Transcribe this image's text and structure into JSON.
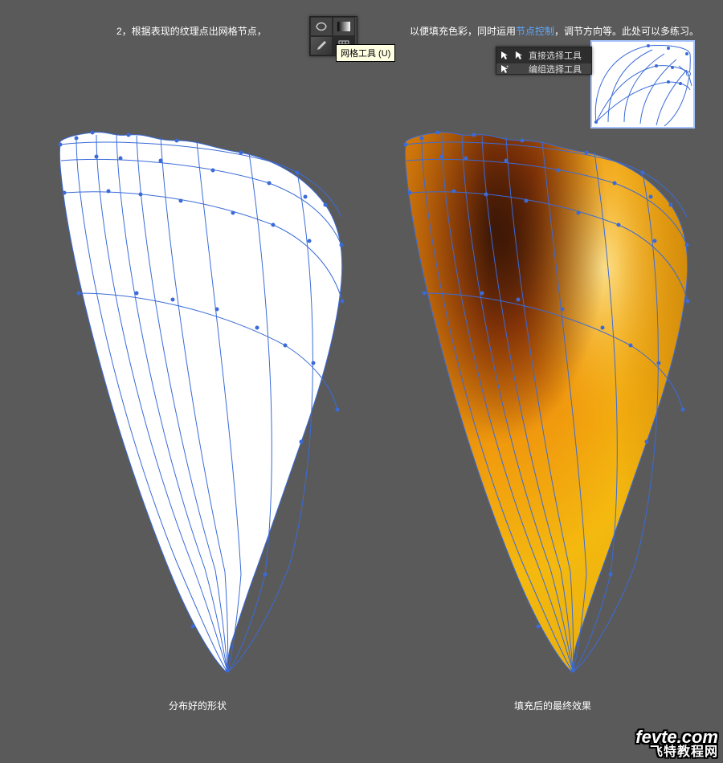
{
  "step_number": "2，",
  "instruction_left": "根据表现的纹理点出网格节点，",
  "instruction_right_a": "以便填充色彩，同时运用",
  "instruction_right_link": "节点控制",
  "instruction_right_b": "，调节方向等。此处可以多练习。",
  "mesh_tooltip": "网格工具 (U)",
  "flyout_row1": "直接选择工具",
  "flyout_row2": "编组选择工具",
  "caption_left": "分布好的形状",
  "caption_right": "填充后的最终效果",
  "watermark_top": "fevte.com",
  "watermark_bottom": "飞特教程网",
  "tool_panel_name": "mesh-tool-panel",
  "flyout_panel_name": "selection-flyout",
  "petal_left_alt": "Petal wireframe with mesh",
  "petal_right_alt": "Petal colored with mesh",
  "colors": {
    "mesh_line": "#3a6bd8",
    "petal_white": "#ffffff",
    "petal_yellow": "#F4B90F",
    "petal_orange": "#E27A0B",
    "petal_dark": "#6B2B0C",
    "petal_highlight": "#FDE89A"
  }
}
